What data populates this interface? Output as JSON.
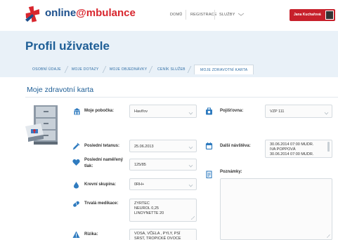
{
  "header": {
    "logo_part1": "online",
    "logo_part2": "@mbulance",
    "nav": [
      "DOMŮ",
      "REGISTRACE",
      "SLUŽBY"
    ],
    "user_name": "Jana Kuchařová"
  },
  "page": {
    "title": "Profil uživatele",
    "tabs": [
      "OSOBNÍ ÚDAJE",
      "MOJE DOTAZY",
      "MOJE OBJEDNÁVKY",
      "CENÍK SLUŽEB",
      "MOJE ZDRAVOTNÍ KARTA"
    ],
    "section_title": "Moje zdravotní karta"
  },
  "left": {
    "branch_label": "Moje pobočka:",
    "branch_value": "Havířov",
    "tetanus_label": "Poslední tetanus:",
    "tetanus_value": "25.06.2013",
    "pressure_label": "Poslední naměřený tlak:",
    "pressure_value": "125/85",
    "blood_label": "Krevní skupina:",
    "blood_value": "0RH+",
    "medication_label": "Trvalá medikace:",
    "medication_value": "ZYRTEC\nNEUROL 0,25\nLINOYNETTE 20",
    "risks_label": "Rizika:",
    "risks_value": "VOSA, VČELA , PYLY, PSÍ\nSRST, TROPICKÉ OVOCE"
  },
  "right": {
    "insurer_label": "Pojišťovna:",
    "insurer_value": "VZP 111",
    "visit_label": "Další návštěva:",
    "visit_value": "30.06.2014 07:00 MUDR.\nIVA POPPOVÁ\n30.06.2014 07:00 MUDR.",
    "notes_label": "Poznámky:",
    "notes_value": ""
  },
  "colors": {
    "brand_blue": "#1e5e96",
    "brand_red": "#d8262e",
    "icon_blue": "#2f7bbf"
  }
}
